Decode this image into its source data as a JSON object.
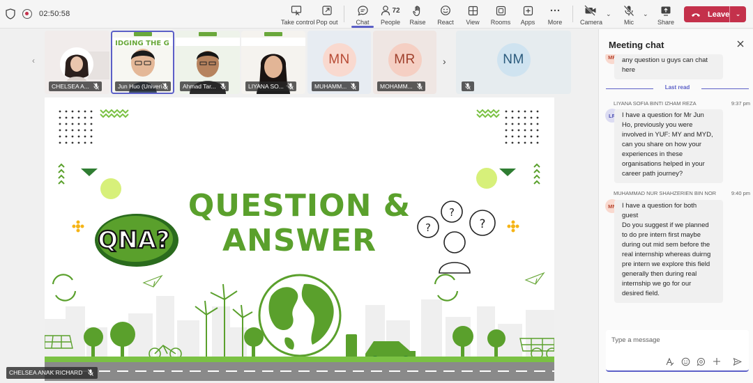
{
  "meeting": {
    "timer": "02:50:58"
  },
  "toolbar": {
    "take_control": "Take control",
    "pop_out": "Pop out",
    "chat": "Chat",
    "people": "People",
    "people_count": "72",
    "raise": "Raise",
    "react": "React",
    "view": "View",
    "rooms": "Rooms",
    "apps": "Apps",
    "more": "More",
    "camera": "Camera",
    "mic": "Mic",
    "share": "Share",
    "leave": "Leave"
  },
  "participants": [
    {
      "name": "CHELSEA A..."
    },
    {
      "name": "Jun Huo (Univeri..."
    },
    {
      "name": "Ahmad Tar..."
    },
    {
      "name": "LIYANA SO..."
    },
    {
      "name": "MUHAMM...",
      "initials": "MN"
    },
    {
      "name": "MOHAMM...",
      "initials": "MR"
    },
    {
      "name": "",
      "initials": "NM"
    }
  ],
  "slide": {
    "line1": "QUESTION &",
    "line2": "ANSWER",
    "badge": "QNA?",
    "banner_text": "IDGING THE G"
  },
  "self_view": {
    "name": "CHELSEA ANAK RICHARD"
  },
  "chat": {
    "title": "Meeting chat",
    "last_read": "Last read",
    "messages": [
      {
        "initials": "MR",
        "text": "any question u guys can chat\nhere"
      },
      {
        "initials": "LR",
        "sender": "LIYANA SOFIA BINTI IZHAM REZA",
        "time": "9:37 pm",
        "text": "I have a question for Mr Jun\nHo, previously you were\ninvolved in YUF: MY and MYD,\ncan you share on how your\nexperiences in these\norganisations helped in your\ncareer path journey?"
      },
      {
        "initials": "MN",
        "sender": "MUHAMMAD NUR SHAHZERIEN BIN NOR",
        "time": "9:40 pm",
        "text": "I have a question for both\nguest\nDo you suggest if we planned\nto do pre intern first maybe\nduring out mid sem before the\nreal internship whereas duirng\npre intern we explore this field\ngenerally then during real\ninternship we go for our\ndesired field."
      }
    ],
    "compose_placeholder": "Type a message"
  },
  "colors": {
    "accent": "#5b5fc7",
    "leave": "#c4314b",
    "slide_green": "#5aa02c",
    "avatar_mn_bg": "#f9d9cf",
    "avatar_mn_fg": "#b74a34",
    "avatar_nm_bg": "#cfe3f0",
    "avatar_nm_fg": "#2a5a7c",
    "avatar_lr_bg": "#dcdcf2",
    "avatar_lr_fg": "#4f52b2"
  }
}
